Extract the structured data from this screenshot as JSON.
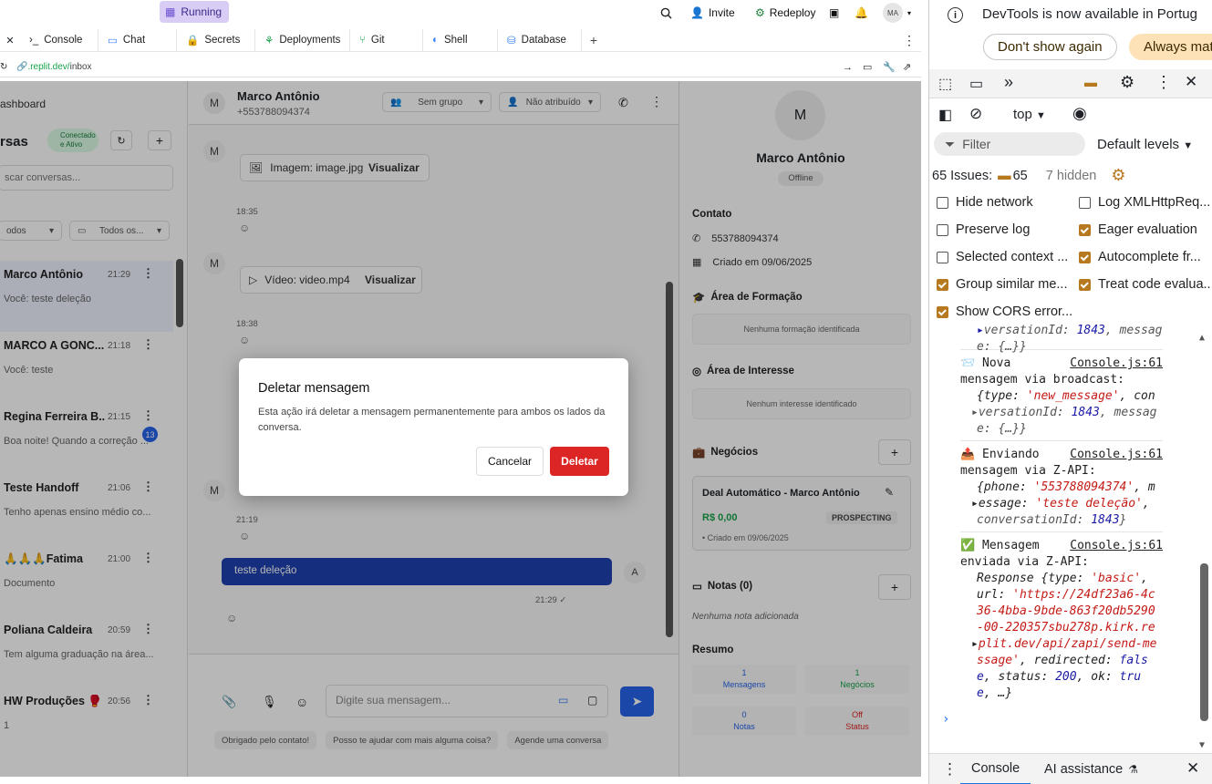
{
  "topbar": {
    "running_label": "Running",
    "invite_label": "Invite",
    "redeploy_label": "Redeploy",
    "avatar_initials": "MA"
  },
  "tabs": [
    {
      "label": "Console"
    },
    {
      "label": "Chat"
    },
    {
      "label": "Secrets"
    },
    {
      "label": "Deployments"
    },
    {
      "label": "Git"
    },
    {
      "label": "Shell"
    },
    {
      "label": "Database"
    }
  ],
  "url": {
    "host": ".replit.dev/",
    "path": "inbox"
  },
  "left": {
    "dashboard_label": "ashboard",
    "conversas_label": "rsas",
    "status_badge": "Conectado e Ativo",
    "search_placeholder": "scar conversas...",
    "filter1": "odos",
    "filter2": "Todos os...",
    "conversations": [
      {
        "name": "Marco Antônio",
        "time": "21:29",
        "preview": "Você: teste deleção"
      },
      {
        "name": "MARCO A GONC...",
        "time": "21:18",
        "preview": "Você: teste"
      },
      {
        "name": "Regina Ferreira B...",
        "time": "21:15",
        "preview": "Boa noite! Quando a correção ...",
        "badge": "13"
      },
      {
        "name": "Teste Handoff",
        "time": "21:06",
        "preview": "Tenho apenas ensino médio co..."
      },
      {
        "name": "🙏🙏🙏Fatima",
        "time": "21:00",
        "preview": "Documento"
      },
      {
        "name": "Poliana Caldeira",
        "time": "20:59",
        "preview": "Tem alguma graduação na área..."
      },
      {
        "name": "HW Produções 🥊",
        "time": "20:56",
        "preview": "1"
      }
    ]
  },
  "chat": {
    "contact_name": "Marco Antônio",
    "contact_phone": "+553788094374",
    "group_select": "Sem grupo",
    "assign_select": "Não atribuído",
    "image_label": "Imagem: image.jpg",
    "video_label": "Vídeo: video.mp4",
    "view_label": "Visualizar",
    "time1": "18:35",
    "time2": "18:38",
    "time3": "21:19",
    "my_message": "teste deleção",
    "my_time": "21:29 ✓",
    "input_placeholder": "Digite sua mensagem...",
    "quick_replies": [
      "Obrigado pelo contato!",
      "Posso te ajudar com mais alguma coisa?",
      "Agende uma conversa"
    ]
  },
  "contact": {
    "avatar": "M",
    "name": "Marco Antônio",
    "status": "Offline",
    "contato_heading": "Contato",
    "phone": "553788094374",
    "created": "Criado em 09/06/2025",
    "formacao_heading": "Área de Formação",
    "formacao_empty": "Nenhuma formação identificada",
    "interesse_heading": "Área de Interesse",
    "interesse_empty": "Nenhum interesse identificado",
    "negocios_heading": "Negócios",
    "deal_title": "Deal Automático - Marco Antônio",
    "deal_value": "R$ 0,00",
    "deal_stage": "PROSPECTING",
    "deal_created": "• Criado em 09/06/2025",
    "notas_heading": "Notas (0)",
    "notas_empty": "Nenhuma nota adicionada",
    "resumo_heading": "Resumo",
    "summary": [
      {
        "value": "1",
        "label": "Mensagens"
      },
      {
        "value": "1",
        "label": "Negócios"
      },
      {
        "value": "0",
        "label": "Notas"
      },
      {
        "value": "Off",
        "label": "Status"
      }
    ]
  },
  "modal": {
    "title": "Deletar mensagem",
    "body": "Esta ação irá deletar a mensagem permanentemente para ambos os lados da conversa.",
    "cancel": "Cancelar",
    "delete": "Deletar"
  },
  "devtools": {
    "info_text": "DevTools is now available in Portug",
    "dont_show": "Don't show again",
    "always": "Always mat",
    "context": "top",
    "filter_placeholder": "Filter",
    "default_levels": "Default levels",
    "issues_label": "65 Issues:",
    "issues_count": "65",
    "hidden": "7 hidden",
    "checkboxes": [
      {
        "label": "Hide network",
        "checked": false
      },
      {
        "label": "Log XMLHttpReq...",
        "checked": false
      },
      {
        "label": "Preserve log",
        "checked": false
      },
      {
        "label": "Eager evaluation",
        "checked": true
      },
      {
        "label": "Selected context ...",
        "checked": false
      },
      {
        "label": "Autocomplete fr...",
        "checked": true
      },
      {
        "label": "Group similar me...",
        "checked": true
      },
      {
        "label": "Treat code evalua...",
        "checked": true
      },
      {
        "label": "Show CORS error...",
        "checked": true
      }
    ],
    "log_src": "Console.js:61",
    "bottom_tab_console": "Console",
    "bottom_tab_ai": "AI assistance"
  },
  "colors": {
    "accent_purple": "#d9ccf5",
    "delete_red": "#dc2626",
    "my_bubble": "#1e40af",
    "dt_checkbox": "#b7791f"
  }
}
